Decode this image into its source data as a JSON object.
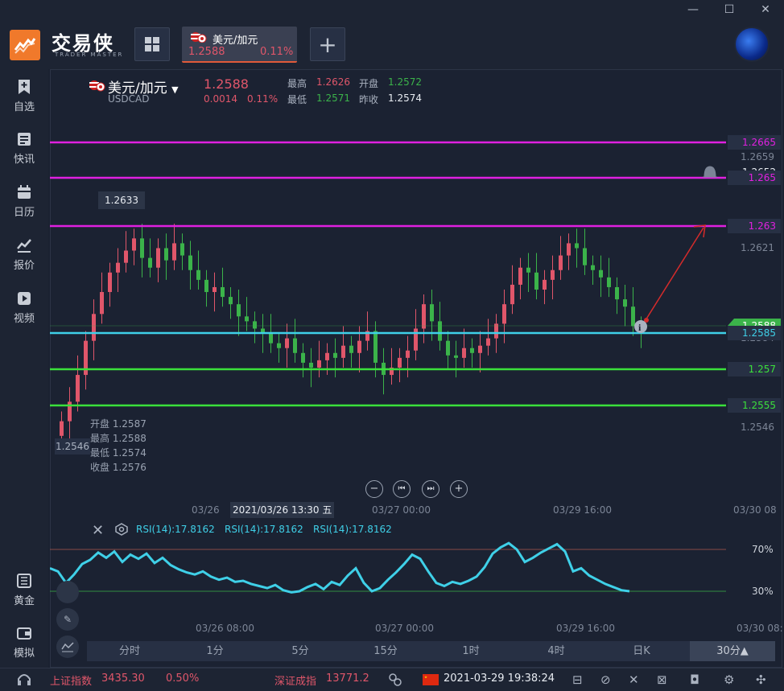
{
  "app": {
    "brand_name": "交易侠",
    "brand_sub": "TRADER MASTER"
  },
  "tab": {
    "name": "美元/加元",
    "price": "1.2588",
    "pct": "0.11%"
  },
  "sidebar": {
    "items": [
      {
        "label": "自选",
        "icon": "bookmark-plus-icon"
      },
      {
        "label": "快讯",
        "icon": "news-icon"
      },
      {
        "label": "日历",
        "icon": "calendar-icon"
      },
      {
        "label": "报价",
        "icon": "quote-chart-icon"
      },
      {
        "label": "视频",
        "icon": "video-icon"
      },
      {
        "label": "黄金",
        "icon": "gold-icon"
      },
      {
        "label": "模拟",
        "icon": "wallet-icon"
      }
    ]
  },
  "symbol": {
    "name": "美元/加元",
    "code": "USDCAD",
    "price": "1.2588",
    "change": "0.0014",
    "pct": "0.11%",
    "high_label": "最高",
    "high": "1.2626",
    "low_label": "最低",
    "low": "1.2571",
    "open_label": "开盘",
    "open": "1.2572",
    "prev_label": "昨收",
    "prev": "1.2574"
  },
  "price_levels": {
    "l1": "1.2665",
    "l2": "1.265",
    "l3": "1.263",
    "l4": "1.2585",
    "l5": "1.257",
    "l6": "1.2555"
  },
  "axis": {
    "y_ticks": [
      "1.2659",
      "1.2652",
      "1.2621",
      "1.2584",
      "1.2546"
    ],
    "current": "1.2588",
    "x_ticks": [
      "03/26",
      "03/27 00:00",
      "03/29 16:00",
      "03/30 08"
    ],
    "cursor_time": "2021/03/26 13:30 五",
    "high_callout": "1.2633",
    "low_callout": "1.2546"
  },
  "ohlc": {
    "open_label": "开盘",
    "open": "1.2587",
    "high_label": "最高",
    "high": "1.2588",
    "low_label": "最低",
    "low": "1.2574",
    "close_label": "收盘",
    "close": "1.2576"
  },
  "rsi": {
    "label1": "RSI(14):17.8162",
    "label2": "RSI(14):17.8162",
    "label3": "RSI(14):17.8162",
    "level_high": "70%",
    "level_low": "30%",
    "x_ticks": [
      "03/26 08:00",
      "03/27 00:00",
      "03/29 16:00",
      "03/30 08:"
    ]
  },
  "periods": [
    "分时",
    "1分",
    "5分",
    "15分",
    "1时",
    "4时",
    "日K",
    "30分▲"
  ],
  "status": {
    "idx1_name": "上证指数",
    "idx1_value": "3435.30",
    "idx1_pct": "0.50%",
    "idx2_name": "深证成指",
    "idx2_value": "13771.2",
    "datetime": "2021-03-29 19:38:24"
  },
  "colors": {
    "up": "#e0566a",
    "down": "#3bb34a",
    "magenta": "#e020e0",
    "cyan": "#3fd0e8",
    "green": "#3be03b"
  },
  "chart_data": {
    "type": "candlestick",
    "title": "美元/加元",
    "x_ticks": [
      "03/26",
      "03/27 00:00",
      "03/29 16:00",
      "03/30 08"
    ],
    "y_ticks": [
      1.2659,
      1.2652,
      1.2621,
      1.2584,
      1.2546
    ],
    "horizontal_levels": [
      1.2665,
      1.265,
      1.263,
      1.2585,
      1.257,
      1.2555
    ],
    "closes": [
      1.2552,
      1.256,
      1.2571,
      1.2585,
      1.2596,
      1.2605,
      1.2613,
      1.2617,
      1.2622,
      1.2627,
      1.2619,
      1.2615,
      1.2623,
      1.2618,
      1.2625,
      1.262,
      1.2614,
      1.261,
      1.2605,
      1.2607,
      1.2603,
      1.26,
      1.2595,
      1.2593,
      1.259,
      1.2588,
      1.2584,
      1.2582,
      1.2586,
      1.258,
      1.2576,
      1.2574,
      1.2577,
      1.258,
      1.2578,
      1.2583,
      1.258,
      1.2585,
      1.2589,
      1.2576,
      1.2571,
      1.2574,
      1.2578,
      1.2581,
      1.259,
      1.26,
      1.2593,
      1.2585,
      1.2579,
      1.2578,
      1.2582,
      1.258,
      1.2583,
      1.2586,
      1.2592,
      1.26,
      1.2608,
      1.2615,
      1.2613,
      1.2606,
      1.261,
      1.2614,
      1.262,
      1.2625,
      1.2623,
      1.2616,
      1.2614,
      1.2611,
      1.2607,
      1.2602,
      1.2599,
      1.2591,
      1.2588
    ],
    "rsi": [
      52,
      49,
      38,
      46,
      56,
      60,
      67,
      62,
      68,
      58,
      65,
      61,
      66,
      57,
      62,
      55,
      51,
      48,
      46,
      49,
      44,
      41,
      43,
      39,
      40,
      37,
      35,
      33,
      36,
      31,
      29,
      30,
      34,
      37,
      32,
      39,
      36,
      45,
      52,
      38,
      30,
      33,
      41,
      48,
      56,
      65,
      61,
      49,
      38,
      35,
      39,
      37,
      40,
      44,
      53,
      66,
      72,
      76,
      70,
      58,
      62,
      67,
      71,
      75,
      68,
      49,
      52,
      45,
      41,
      37,
      34,
      31,
      30
    ]
  }
}
